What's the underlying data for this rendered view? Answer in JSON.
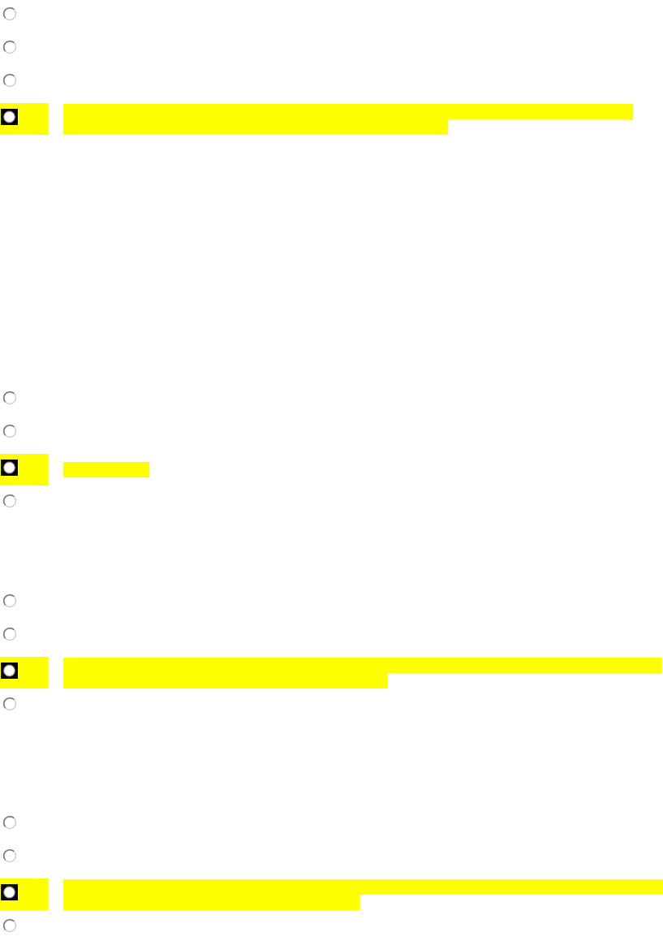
{
  "questions": [
    {
      "options": [
        {
          "selected": false
        },
        {
          "selected": false
        },
        {
          "selected": false
        },
        {
          "selected": true
        }
      ]
    },
    {
      "options": [
        {
          "selected": false
        },
        {
          "selected": false
        },
        {
          "selected": true
        },
        {
          "selected": false
        }
      ]
    },
    {
      "options": [
        {
          "selected": false
        },
        {
          "selected": false
        },
        {
          "selected": true
        },
        {
          "selected": false
        }
      ]
    },
    {
      "options": [
        {
          "selected": false
        },
        {
          "selected": false
        },
        {
          "selected": true
        },
        {
          "selected": false
        }
      ]
    }
  ]
}
